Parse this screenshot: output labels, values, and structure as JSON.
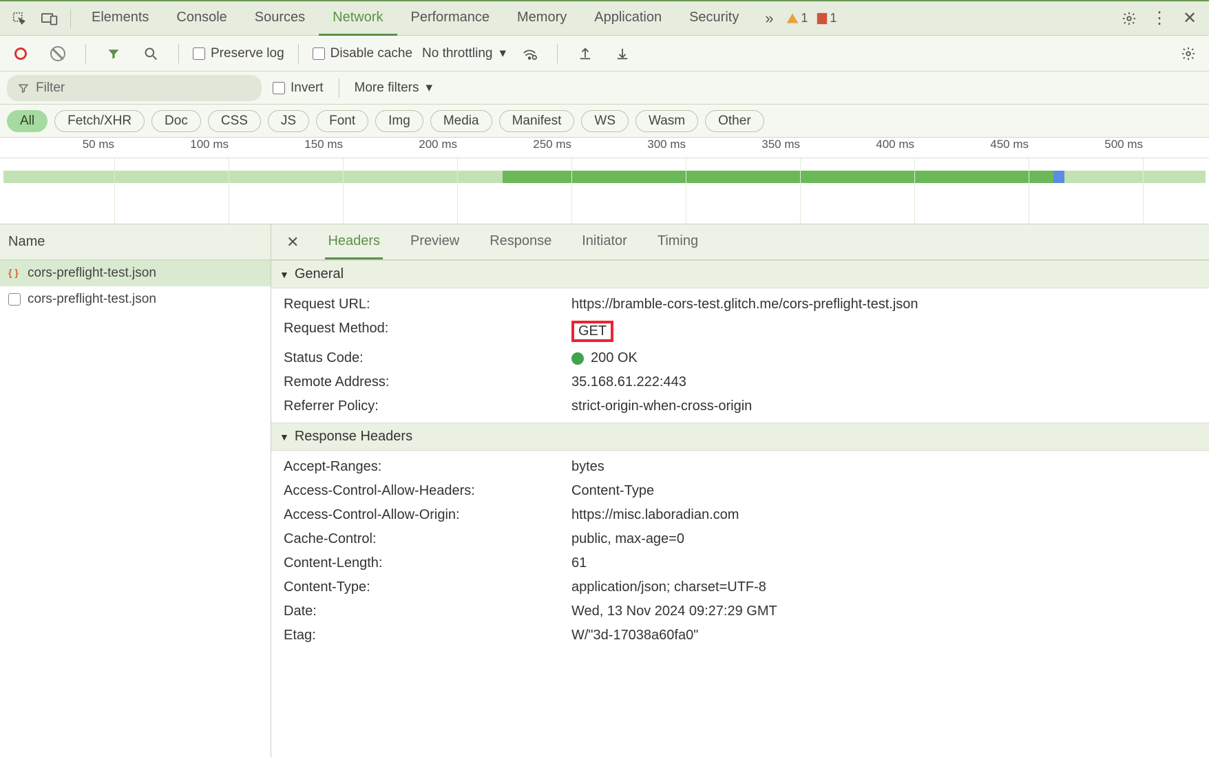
{
  "main_tabs": [
    "Elements",
    "Console",
    "Sources",
    "Network",
    "Performance",
    "Memory",
    "Application",
    "Security"
  ],
  "main_tab_active": "Network",
  "warn_count": "1",
  "issue_count": "1",
  "preserve_log": "Preserve log",
  "disable_cache": "Disable cache",
  "throttling": "No throttling",
  "filter_placeholder": "Filter",
  "invert": "Invert",
  "more_filters": "More filters",
  "type_filters": [
    "All",
    "Fetch/XHR",
    "Doc",
    "CSS",
    "JS",
    "Font",
    "Img",
    "Media",
    "Manifest",
    "WS",
    "Wasm",
    "Other"
  ],
  "type_active": "All",
  "ticks": [
    "50 ms",
    "100 ms",
    "150 ms",
    "200 ms",
    "250 ms",
    "300 ms",
    "350 ms",
    "400 ms",
    "450 ms",
    "500 ms"
  ],
  "name_header": "Name",
  "files": [
    "cors-preflight-test.json",
    "cors-preflight-test.json"
  ],
  "detail_tabs": [
    "Headers",
    "Preview",
    "Response",
    "Initiator",
    "Timing"
  ],
  "detail_active": "Headers",
  "sections": {
    "general": {
      "title": "General",
      "rows": [
        {
          "k": "Request URL:",
          "v": "https://bramble-cors-test.glitch.me/cors-preflight-test.json"
        },
        {
          "k": "Request Method:",
          "v": "GET"
        },
        {
          "k": "Status Code:",
          "v": "200 OK"
        },
        {
          "k": "Remote Address:",
          "v": "35.168.61.222:443"
        },
        {
          "k": "Referrer Policy:",
          "v": "strict-origin-when-cross-origin"
        }
      ]
    },
    "response": {
      "title": "Response Headers",
      "rows": [
        {
          "k": "Accept-Ranges:",
          "v": "bytes"
        },
        {
          "k": "Access-Control-Allow-Headers:",
          "v": "Content-Type"
        },
        {
          "k": "Access-Control-Allow-Origin:",
          "v": "https://misc.laboradian.com"
        },
        {
          "k": "Cache-Control:",
          "v": "public, max-age=0"
        },
        {
          "k": "Content-Length:",
          "v": "61"
        },
        {
          "k": "Content-Type:",
          "v": "application/json; charset=UTF-8"
        },
        {
          "k": "Date:",
          "v": "Wed, 13 Nov 2024 09:27:29 GMT"
        },
        {
          "k": "Etag:",
          "v": "W/\"3d-17038a60fa0\""
        }
      ]
    }
  }
}
